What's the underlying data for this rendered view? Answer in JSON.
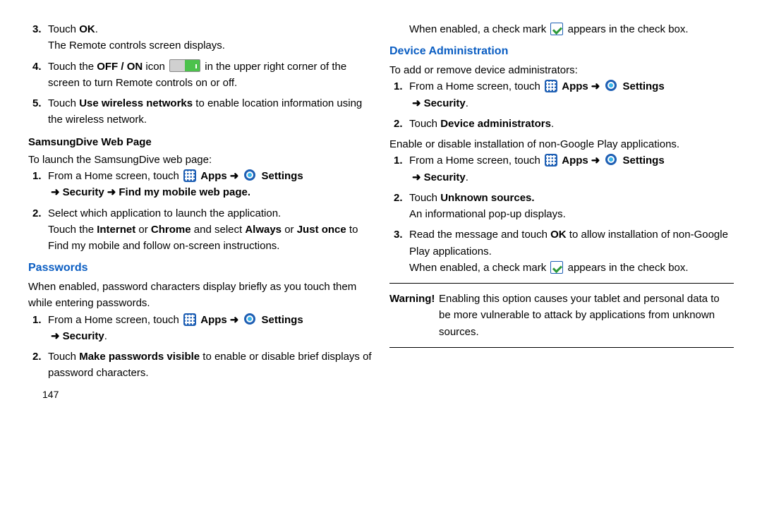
{
  "left": {
    "s3_pre": "Touch ",
    "s3_b": "OK",
    "s3_post": ".",
    "s3_l2": "The Remote controls screen displays.",
    "s4_pre": "Touch the ",
    "s4_b": "OFF / ON",
    "s4_mid": " icon ",
    "s4_post": " in the upper right corner of the screen to turn Remote controls on or off.",
    "s5_pre": "Touch ",
    "s5_b": "Use wireless networks",
    "s5_post": " to enable location information using the wireless network.",
    "samsungdive_head": "SamsungDive Web Page",
    "samsungdive_intro": "To launch the SamsungDive web page:",
    "sd1_pre": "From a Home screen, touch ",
    "sd1_apps": "Apps",
    "sd1_settings": "Settings",
    "sd1_path": "Security",
    "sd1_path2": "Find my mobile web page",
    "sd2a": "Select which application to launch the application.",
    "sd2b_pre": "Touch the ",
    "sd2b_b1": "Internet",
    "sd2b_mid1": " or ",
    "sd2b_b2": "Chrome",
    "sd2b_mid2": "  and select ",
    "sd2b_b3": "Always",
    "sd2b_mid3": " or ",
    "sd2b_b4": "Just once",
    "sd2b_post": " to Find my mobile and follow on-screen instructions.",
    "passwords_head": "Passwords",
    "passwords_intro": "When enabled, password characters display briefly as you touch them while entering passwords.",
    "pw1_pre": "From a Home screen, touch ",
    "pw1_apps": "Apps",
    "pw1_settings": "Settings",
    "pw1_path": "Security",
    "pw2_pre": "Touch ",
    "pw2_b": "Make passwords visible",
    "pw2_post": " to enable or disable brief displays of password characters.",
    "page_num": "147"
  },
  "right": {
    "top_pre": "When enabled, a check mark ",
    "top_post": " appears in the check box.",
    "devadmin_head": "Device Administration",
    "devadmin_intro": "To add or remove device administrators:",
    "da1_pre": "From a Home screen, touch ",
    "da1_apps": "Apps",
    "da1_settings": "Settings",
    "da1_path": "Security",
    "da2_pre": "Touch ",
    "da2_b": "Device administrators",
    "nongoogle_intro": "Enable or disable installation of non-Google Play applications.",
    "ng1_pre": "From a Home screen, touch ",
    "ng1_apps": "Apps",
    "ng1_settings": "Settings",
    "ng1_path": "Security",
    "ng2_pre": "Touch ",
    "ng2_b": "Unknown sources.",
    "ng2_l2": "An informational pop-up displays.",
    "ng3_pre": "Read the message and touch ",
    "ng3_b": "OK",
    "ng3_post": " to allow installation of non-Google Play applications.",
    "ng3_l2_pre": "When enabled, a check mark ",
    "ng3_l2_post": " appears in the check box.",
    "warning_label": "Warning!",
    "warning_body": "Enabling this option causes your tablet and personal data to be more vulnerable to attack by applications from unknown sources."
  }
}
